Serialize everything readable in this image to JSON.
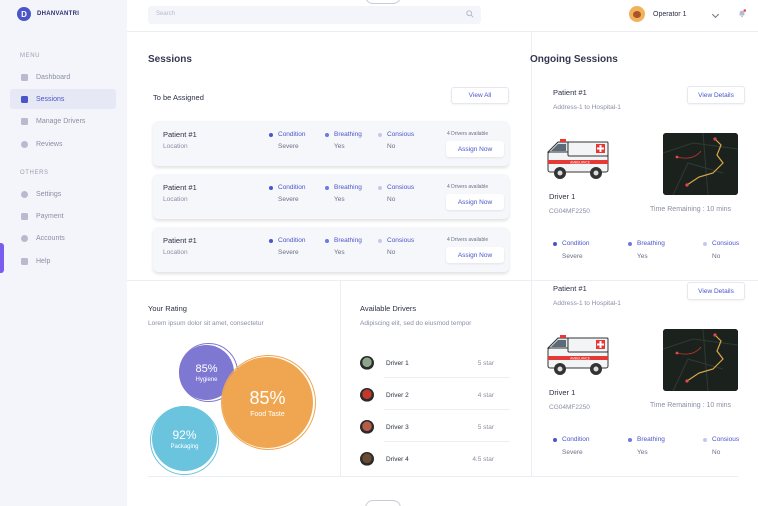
{
  "brand": {
    "initial": "D",
    "name": "DHANVANTRI"
  },
  "sidebar": {
    "menu_label": "MENU",
    "others_label": "OTHERS",
    "menu_items": [
      {
        "label": "Dashboard",
        "icon": "dashboard-icon"
      },
      {
        "label": "Sessions",
        "icon": "sessions-icon",
        "active": true
      },
      {
        "label": "Manage Drivers",
        "icon": "drivers-icon"
      },
      {
        "label": "Reviews",
        "icon": "reviews-icon"
      }
    ],
    "other_items": [
      {
        "label": "Settings",
        "icon": "settings-icon"
      },
      {
        "label": "Payment",
        "icon": "payment-icon"
      },
      {
        "label": "Accounts",
        "icon": "accounts-icon"
      },
      {
        "label": "Help",
        "icon": "help-icon"
      }
    ]
  },
  "header": {
    "search_placeholder": "Search",
    "user_name": "Operator 1"
  },
  "sessions": {
    "title": "Sessions",
    "subtitle": "To be Assigned",
    "view_all": "View All",
    "cards": [
      {
        "name": "Patient #1",
        "location": "Location",
        "condition_label": "Condition",
        "condition": "Severe",
        "breathing_label": "Breathing",
        "breathing": "Yes",
        "conscious_label": "Consious",
        "conscious": "No",
        "available": "4 Drivers available",
        "assign": "Assign Now"
      },
      {
        "name": "Patient #1",
        "location": "Location",
        "condition_label": "Condition",
        "condition": "Severe",
        "breathing_label": "Breathing",
        "breathing": "Yes",
        "conscious_label": "Consious",
        "conscious": "No",
        "available": "4 Drivers available",
        "assign": "Assign Now"
      },
      {
        "name": "Patient #1",
        "location": "Location",
        "condition_label": "Condition",
        "condition": "Severe",
        "breathing_label": "Breathing",
        "breathing": "Yes",
        "conscious_label": "Consious",
        "conscious": "No",
        "available": "4 Drivers available",
        "assign": "Assign Now"
      }
    ]
  },
  "rating": {
    "title": "Your Rating",
    "subtitle": "Lorem ipsum dolor sit amet, consectetur",
    "hygiene": {
      "value": "85%",
      "label": "Hygiene"
    },
    "food": {
      "value": "85%",
      "label": "Food Taste"
    },
    "packaging": {
      "value": "92%",
      "label": "Packaging"
    }
  },
  "drivers": {
    "title": "Available Drivers",
    "subtitle": "Adipiscing elit, sed do eiusmod tempor",
    "list": [
      {
        "name": "Driver 1",
        "rating": "5 star"
      },
      {
        "name": "Driver 2",
        "rating": "4 star"
      },
      {
        "name": "Driver 3",
        "rating": "5 star"
      },
      {
        "name": "Driver 4",
        "rating": "4.5 star"
      }
    ]
  },
  "ongoing": {
    "title": "Ongoing Sessions",
    "items": [
      {
        "patient": "Patient #1",
        "address": "Address-1 to Hospital-1",
        "view": "View Details",
        "driver": "Driver 1",
        "plate": "CG04MF2250",
        "time": "Time Remaining : 10 mins",
        "condition_label": "Condition",
        "condition": "Severe",
        "breathing_label": "Breathing",
        "breathing": "Yes",
        "conscious_label": "Consious",
        "conscious": "No",
        "ambulance_text": "AMBULANCE"
      },
      {
        "patient": "Patient #1",
        "address": "Address-1 to Hospital-1",
        "view": "View Details",
        "driver": "Driver 1",
        "plate": "CG04MF2250",
        "time": "Time Remaining : 10 mins",
        "condition_label": "Condition",
        "condition": "Severe",
        "breathing_label": "Breathing",
        "breathing": "Yes",
        "conscious_label": "Consious",
        "conscious": "No",
        "ambulance_text": "AMBULANCE"
      }
    ]
  },
  "colors": {
    "accent": "#4a55c7",
    "dot_condition": "#4a55c7",
    "dot_breathing": "#6d7ae0",
    "dot_conscious": "#c3c8f0",
    "hygiene": "#7f78d2",
    "food": "#f0a650",
    "packaging": "#6bc4de"
  }
}
